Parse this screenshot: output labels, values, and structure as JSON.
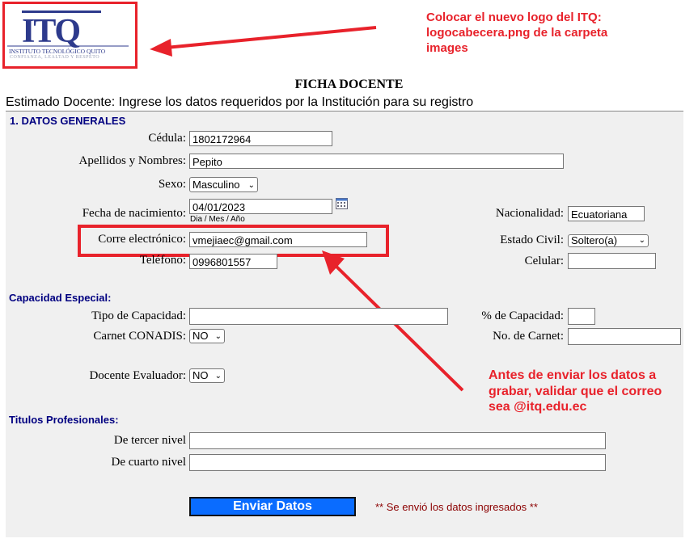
{
  "logo": {
    "mark": "ITQ",
    "name": "INSTITUTO TECNOLÓGICO QUITO",
    "tagline": "CONFIANZA, LEALTAD Y RESPETO"
  },
  "annotations": {
    "logo_note": "Colocar el nuevo logo del ITQ: logocabecera.png de la carpeta images",
    "email_note": "Antes de enviar los datos a grabar, validar que el correo sea @itq.edu.ec"
  },
  "form": {
    "title": "FICHA DOCENTE",
    "intro": "Estimado Docente: Ingrese los datos requeridos por la Institución para su registro",
    "general": {
      "heading": "1. DATOS GENERALES",
      "cedula_label": "Cédula:",
      "cedula_value": "1802172964",
      "nombres_label": "Apellidos y Nombres:",
      "nombres_value": "Pepito",
      "sexo_label": "Sexo:",
      "sexo_value": "Masculino",
      "nacimiento_label": "Fecha de nacimiento:",
      "nacimiento_value": "04/01/2023",
      "nacimiento_hint": "Dia / Mes / Año",
      "nacionalidad_label": "Nacionalidad:",
      "nacionalidad_value": "Ecuatoriana",
      "correo_label": "Corre electrónico:",
      "correo_value": "vmejiaec@gmail.com",
      "estado_label": "Estado Civil:",
      "estado_value": "Soltero(a)",
      "telefono_label": "Teléfono:",
      "telefono_value": "0996801557",
      "celular_label": "Celular:",
      "celular_value": ""
    },
    "capacidad": {
      "heading": "Capacidad Especial:",
      "tipo_label": "Tipo de Capacidad:",
      "tipo_value": "",
      "porcentaje_label": "% de Capacidad:",
      "porcentaje_value": "",
      "conadis_label": "Carnet CONADIS:",
      "conadis_value": "NO",
      "carnet_label": "No. de Carnet:",
      "carnet_value": "",
      "evaluador_label": "Docente Evaluador:",
      "evaluador_value": "NO"
    },
    "titulos": {
      "heading": "Titulos Profesionales:",
      "tercer_label": "De tercer nivel",
      "tercer_value": "",
      "cuarto_label": "De cuarto nivel",
      "cuarto_value": ""
    },
    "submit_label": "Enviar Datos",
    "status_message": "** Se envió los datos ingresados **"
  },
  "colors": {
    "annotation_red": "#e8222b",
    "section_blue": "#000080",
    "button_blue": "#0a6cff",
    "form_bg": "#f0f0f0",
    "status_red": "#8b0000"
  }
}
